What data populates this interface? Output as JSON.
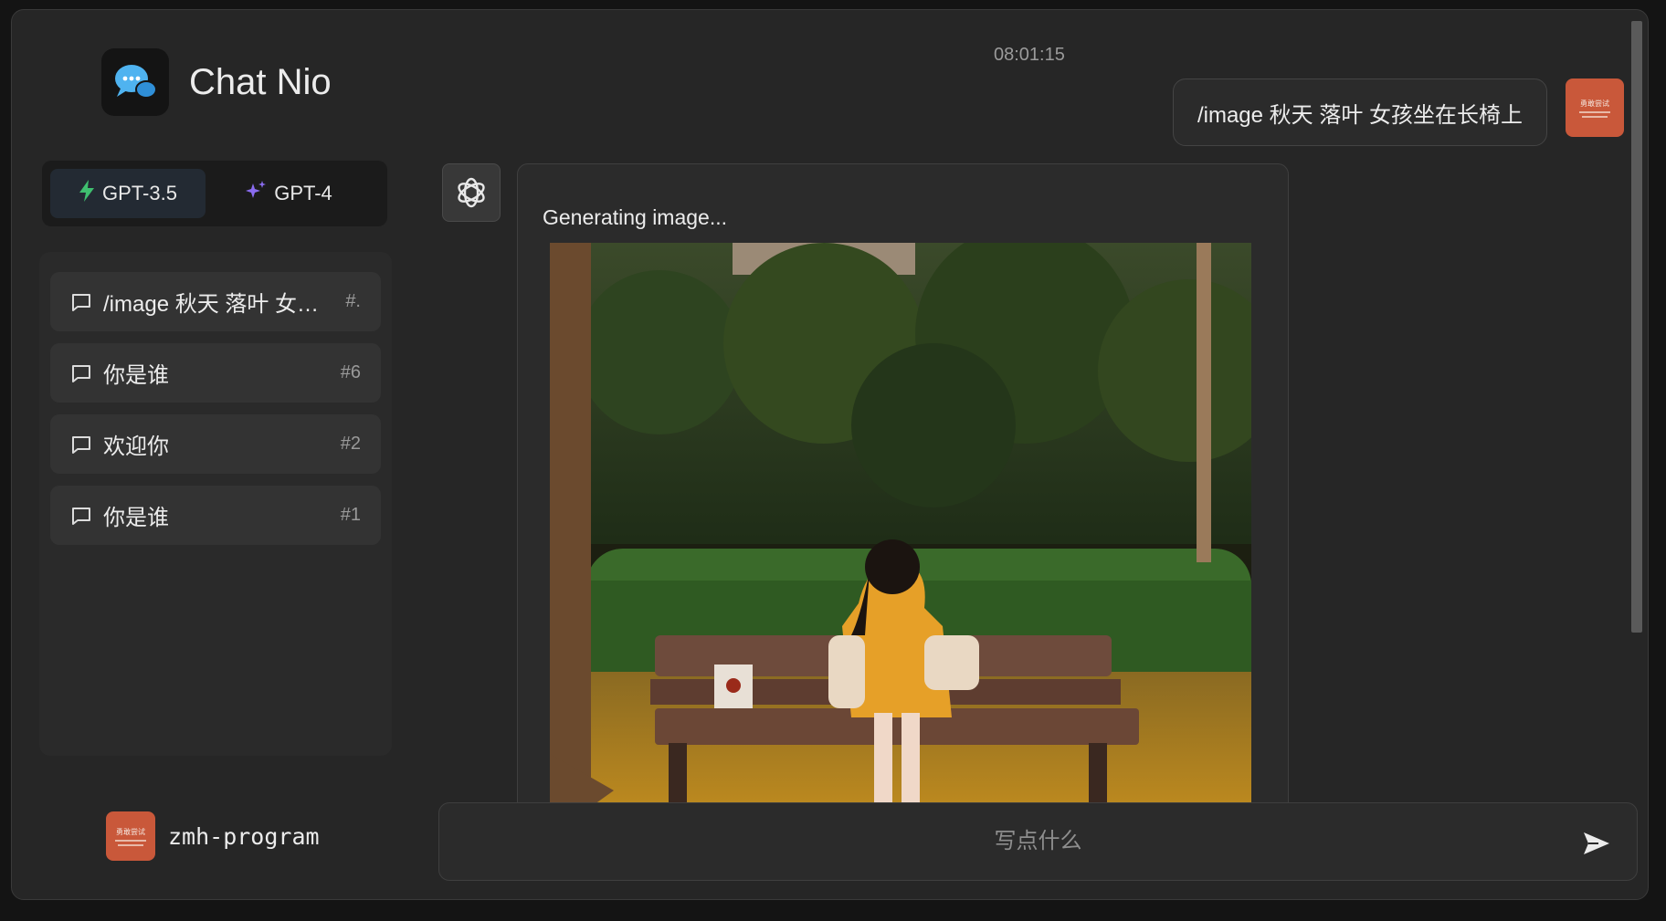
{
  "app": {
    "title": "Chat Nio"
  },
  "models": [
    {
      "label": "GPT-3.5",
      "active": true
    },
    {
      "label": "GPT-4",
      "active": false
    }
  ],
  "conversations": [
    {
      "label": "/image 秋天 落叶 女孩坐在长椅上",
      "id": "#."
    },
    {
      "label": "你是谁",
      "id": "#6"
    },
    {
      "label": "欢迎你",
      "id": "#2"
    },
    {
      "label": "你是谁",
      "id": "#1"
    }
  ],
  "user": {
    "name": "zmh-program",
    "avatar_text": "勇敢尝试"
  },
  "chat": {
    "timestamp": "08:01:15",
    "user_message": "/image 秋天 落叶 女孩坐在长椅上",
    "bot_message": "Generating image..."
  },
  "input": {
    "placeholder": "写点什么"
  },
  "colors": {
    "accent_green": "#3fbf6f",
    "accent_purple": "#8a6cf0",
    "avatar": "#c9583a",
    "brand_blue": "#3aa0e8"
  }
}
